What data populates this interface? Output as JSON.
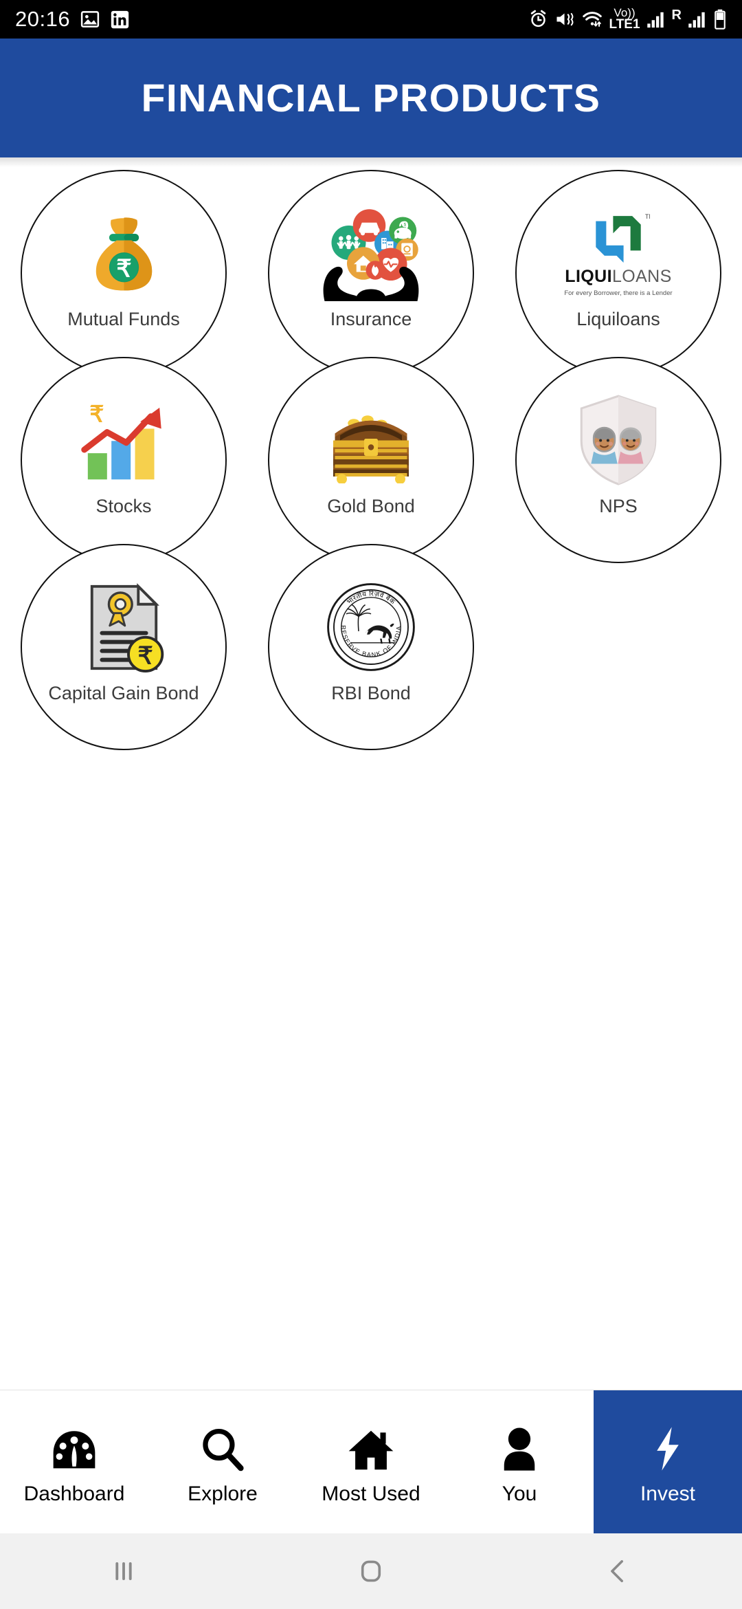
{
  "statusbar": {
    "time": "20:16",
    "left_icons": [
      "image-icon",
      "linkedin-icon"
    ],
    "right_icons": [
      "alarm-icon",
      "mute-vibrate-icon",
      "wifi-icon",
      "volte-icon",
      "signal-sim1-icon",
      "roaming-icon",
      "signal-sim2-icon",
      "battery-icon"
    ],
    "network_label": "Vo))",
    "network_sub": "LTE1",
    "roaming_label": "R"
  },
  "header": {
    "title": "FINANCIAL PRODUCTS",
    "bg_color": "#1F4B9E"
  },
  "products": [
    {
      "label": "Mutual Funds",
      "icon": "money-bag-rupee-icon"
    },
    {
      "label": "Insurance",
      "icon": "hands-holding-insurance-icons"
    },
    {
      "label": "Liquiloans",
      "icon": "liquiloans-logo",
      "logo_text_bold": "LIQUI",
      "logo_text_light": "LOANS",
      "logo_tm": "TM",
      "logo_tagline": "For every Borrower, there is a Lender"
    },
    {
      "label": "Stocks",
      "icon": "growth-chart-rupee-icon"
    },
    {
      "label": "Gold Bond",
      "icon": "treasure-chest-gold-icon"
    },
    {
      "label": "NPS",
      "icon": "elderly-couple-shield-icon"
    },
    {
      "label": "Capital Gain Bond",
      "icon": "document-rupee-coin-icon"
    },
    {
      "label": "RBI Bond",
      "icon": "rbi-seal-icon",
      "seal_text_top": "भारतीय रिज़र्व बैंक",
      "seal_text_bottom": "RESERVE BANK OF INDIA"
    }
  ],
  "bottom_nav": {
    "active_index": 4,
    "active_color": "#1F4B9E",
    "items": [
      {
        "label": "Dashboard",
        "icon": "dashboard-gauge-icon"
      },
      {
        "label": "Explore",
        "icon": "search-magnifier-icon"
      },
      {
        "label": "Most Used",
        "icon": "home-icon"
      },
      {
        "label": "You",
        "icon": "person-icon"
      },
      {
        "label": "Invest",
        "icon": "lightning-bolt-icon"
      }
    ]
  },
  "android_nav": {
    "items": [
      {
        "name": "recents-button",
        "icon": "three-bars-icon"
      },
      {
        "name": "home-button",
        "icon": "rounded-square-icon"
      },
      {
        "name": "back-button",
        "icon": "chevron-left-icon"
      }
    ]
  }
}
